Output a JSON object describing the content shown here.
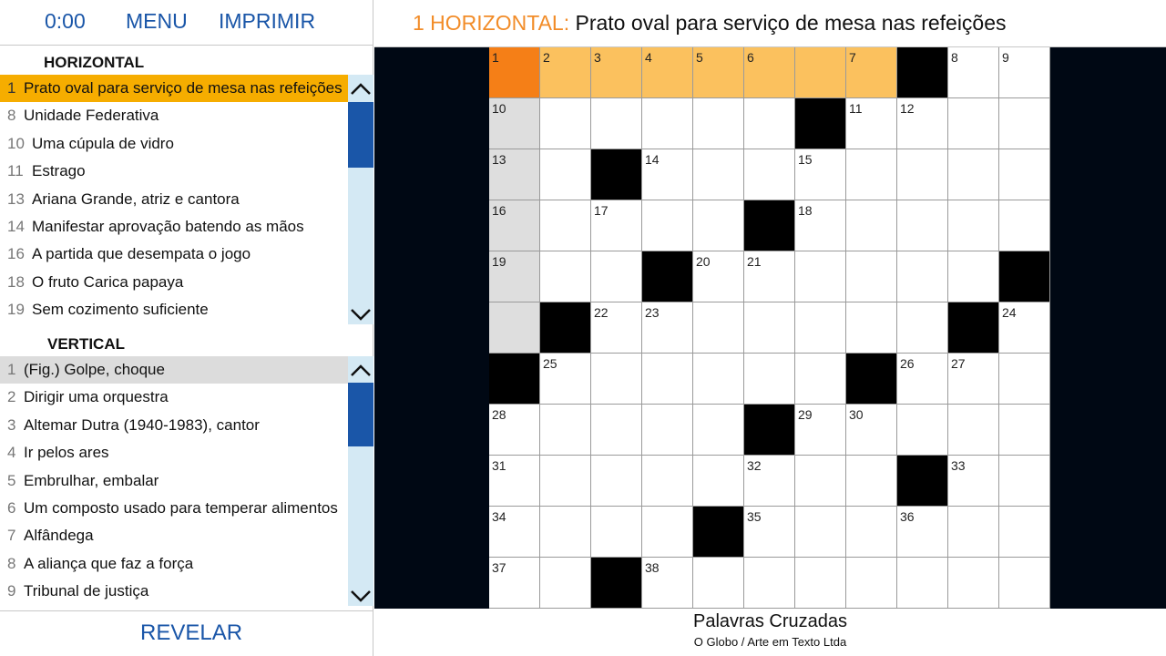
{
  "topbar": {
    "timer": "0:00",
    "menu_label": "MENU",
    "print_label": "IMPRIMIR"
  },
  "horizontal": {
    "header": "HORIZONTAL",
    "clues": [
      {
        "num": "1",
        "text": "Prato oval para serviço de mesa nas refeições"
      },
      {
        "num": "8",
        "text": "Unidade Federativa"
      },
      {
        "num": "10",
        "text": "Uma cúpula de vidro"
      },
      {
        "num": "11",
        "text": "Estrago"
      },
      {
        "num": "13",
        "text": "Ariana Grande, atriz e cantora"
      },
      {
        "num": "14",
        "text": "Manifestar aprovação batendo as mãos"
      },
      {
        "num": "16",
        "text": "A partida que desempata o jogo"
      },
      {
        "num": "18",
        "text": "O fruto Carica papaya"
      },
      {
        "num": "19",
        "text": "Sem cozimento suficiente"
      }
    ]
  },
  "vertical": {
    "header": "VERTICAL",
    "clues": [
      {
        "num": "1",
        "text": "(Fig.) Golpe, choque"
      },
      {
        "num": "2",
        "text": "Dirigir uma orquestra"
      },
      {
        "num": "3",
        "text": "Altemar Dutra (1940-1983), cantor"
      },
      {
        "num": "4",
        "text": "Ir pelos ares"
      },
      {
        "num": "5",
        "text": "Embrulhar, embalar"
      },
      {
        "num": "6",
        "text": "Um composto usado para temperar alimentos"
      },
      {
        "num": "7",
        "text": "Alfândega"
      },
      {
        "num": "8",
        "text": "A aliança que faz a força"
      },
      {
        "num": "9",
        "text": "Tribunal de justiça"
      }
    ]
  },
  "reveal_label": "REVELAR",
  "current_clue": {
    "label": "1 HORIZONTAL:",
    "text": "Prato oval para serviço de mesa nas refeições"
  },
  "footer": {
    "title": "Palavras Cruzadas",
    "credit": "O Globo / Arte em Texto Ltda"
  },
  "colors": {
    "accent_blue": "#1a56a8",
    "active_clue": "#f6ad00",
    "current_word": "#fbc15e",
    "cursor_cell": "#f57f17",
    "crossing_word": "#dedede",
    "scroll_track": "#d4e9f4"
  },
  "icons": {
    "scroll_up": "chevron-up-icon",
    "scroll_down": "chevron-down-icon"
  },
  "grid": {
    "rows": 11,
    "cols": 11,
    "blocks": [
      [
        0,
        8
      ],
      [
        1,
        6
      ],
      [
        2,
        2
      ],
      [
        3,
        5
      ],
      [
        4,
        3
      ],
      [
        4,
        10
      ],
      [
        5,
        1
      ],
      [
        5,
        9
      ],
      [
        6,
        0
      ],
      [
        6,
        7
      ],
      [
        7,
        5
      ],
      [
        8,
        8
      ],
      [
        9,
        4
      ],
      [
        10,
        2
      ]
    ],
    "current_word_cells": [
      [
        0,
        0
      ],
      [
        0,
        1
      ],
      [
        0,
        2
      ],
      [
        0,
        3
      ],
      [
        0,
        4
      ],
      [
        0,
        5
      ],
      [
        0,
        6
      ],
      [
        0,
        7
      ]
    ],
    "cursor_cell": [
      0,
      0
    ],
    "crossing_word_cells": [
      [
        1,
        0
      ],
      [
        2,
        0
      ],
      [
        3,
        0
      ],
      [
        4,
        0
      ],
      [
        5,
        0
      ]
    ],
    "numbers": [
      {
        "r": 0,
        "c": 0,
        "n": "1"
      },
      {
        "r": 0,
        "c": 1,
        "n": "2"
      },
      {
        "r": 0,
        "c": 2,
        "n": "3"
      },
      {
        "r": 0,
        "c": 3,
        "n": "4"
      },
      {
        "r": 0,
        "c": 4,
        "n": "5"
      },
      {
        "r": 0,
        "c": 5,
        "n": "6"
      },
      {
        "r": 0,
        "c": 7,
        "n": "7"
      },
      {
        "r": 0,
        "c": 9,
        "n": "8"
      },
      {
        "r": 0,
        "c": 10,
        "n": "9"
      },
      {
        "r": 1,
        "c": 0,
        "n": "10"
      },
      {
        "r": 1,
        "c": 7,
        "n": "11"
      },
      {
        "r": 1,
        "c": 8,
        "n": "12"
      },
      {
        "r": 2,
        "c": 0,
        "n": "13"
      },
      {
        "r": 2,
        "c": 3,
        "n": "14"
      },
      {
        "r": 2,
        "c": 6,
        "n": "15"
      },
      {
        "r": 3,
        "c": 0,
        "n": "16"
      },
      {
        "r": 3,
        "c": 2,
        "n": "17"
      },
      {
        "r": 3,
        "c": 6,
        "n": "18"
      },
      {
        "r": 4,
        "c": 0,
        "n": "19"
      },
      {
        "r": 4,
        "c": 4,
        "n": "20"
      },
      {
        "r": 4,
        "c": 5,
        "n": "21"
      },
      {
        "r": 5,
        "c": 2,
        "n": "22"
      },
      {
        "r": 5,
        "c": 3,
        "n": "23"
      },
      {
        "r": 5,
        "c": 10,
        "n": "24"
      },
      {
        "r": 6,
        "c": 1,
        "n": "25"
      },
      {
        "r": 6,
        "c": 8,
        "n": "26"
      },
      {
        "r": 6,
        "c": 9,
        "n": "27"
      },
      {
        "r": 7,
        "c": 0,
        "n": "28"
      },
      {
        "r": 7,
        "c": 6,
        "n": "29"
      },
      {
        "r": 7,
        "c": 7,
        "n": "30"
      },
      {
        "r": 8,
        "c": 0,
        "n": "31"
      },
      {
        "r": 8,
        "c": 5,
        "n": "32"
      },
      {
        "r": 8,
        "c": 9,
        "n": "33"
      },
      {
        "r": 9,
        "c": 0,
        "n": "34"
      },
      {
        "r": 9,
        "c": 5,
        "n": "35"
      },
      {
        "r": 9,
        "c": 8,
        "n": "36"
      },
      {
        "r": 10,
        "c": 0,
        "n": "37"
      },
      {
        "r": 10,
        "c": 3,
        "n": "38"
      }
    ]
  }
}
